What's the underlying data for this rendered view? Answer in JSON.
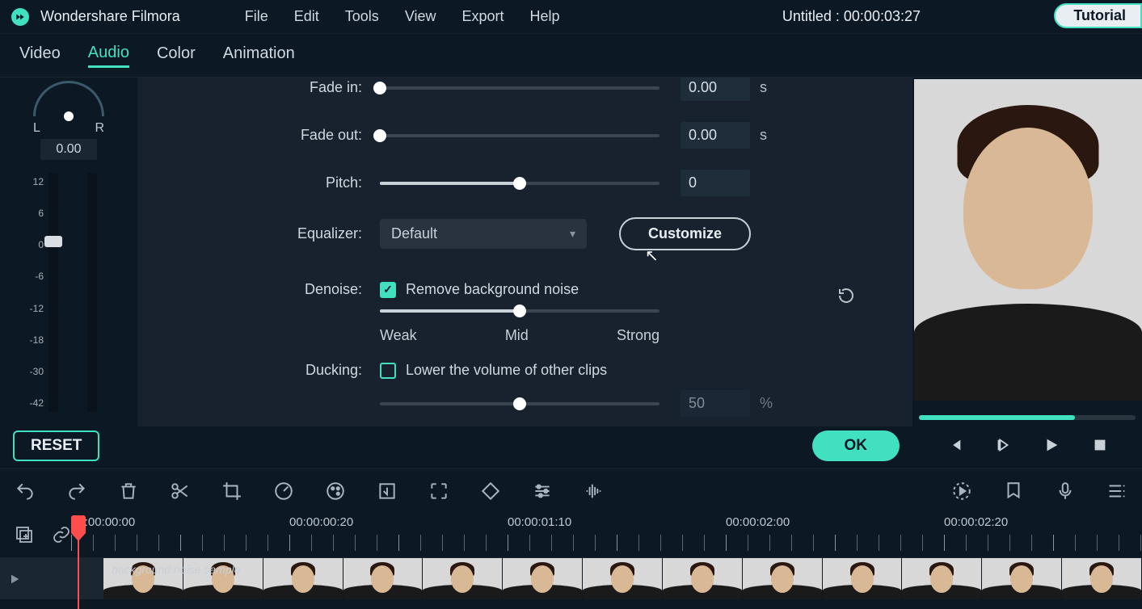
{
  "app": {
    "title": "Wondershare Filmora"
  },
  "menubar": {
    "file": "File",
    "edit": "Edit",
    "tools": "Tools",
    "view": "View",
    "export": "Export",
    "help": "Help"
  },
  "doc": {
    "title": "Untitled : 00:00:03:27"
  },
  "tutorial": {
    "label": "Tutorial"
  },
  "tabs": {
    "video": "Video",
    "audio": "Audio",
    "color": "Color",
    "animation": "Animation"
  },
  "balance": {
    "L": "L",
    "R": "R",
    "value": "0.00"
  },
  "gain_ticks": [
    "12",
    "6",
    "0",
    "-6",
    "-12",
    "-18",
    "-30",
    "-42"
  ],
  "audio": {
    "fade_in": {
      "label": "Fade in:",
      "value": "0.00",
      "unit": "s",
      "pos": 0
    },
    "fade_out": {
      "label": "Fade out:",
      "value": "0.00",
      "unit": "s",
      "pos": 0
    },
    "pitch": {
      "label": "Pitch:",
      "value": "0",
      "pos": 50
    },
    "equalizer": {
      "label": "Equalizer:",
      "selected": "Default",
      "customize": "Customize"
    },
    "denoise": {
      "label": "Denoise:",
      "checkbox_label": "Remove background noise",
      "checked": true,
      "pos": 50,
      "weak": "Weak",
      "mid": "Mid",
      "strong": "Strong"
    },
    "ducking": {
      "label": "Ducking:",
      "checkbox_label": "Lower the volume of other clips",
      "checked": false,
      "value": "50",
      "unit": "%",
      "pos": 50
    }
  },
  "buttons": {
    "reset": "RESET",
    "ok": "OK"
  },
  "timeline": {
    "labels": [
      "00:00:00:00",
      "00:00:00:20",
      "00:00:01:10",
      "00:00:02:00",
      "00:00:02:20"
    ],
    "clip_name": "background noise sample"
  }
}
